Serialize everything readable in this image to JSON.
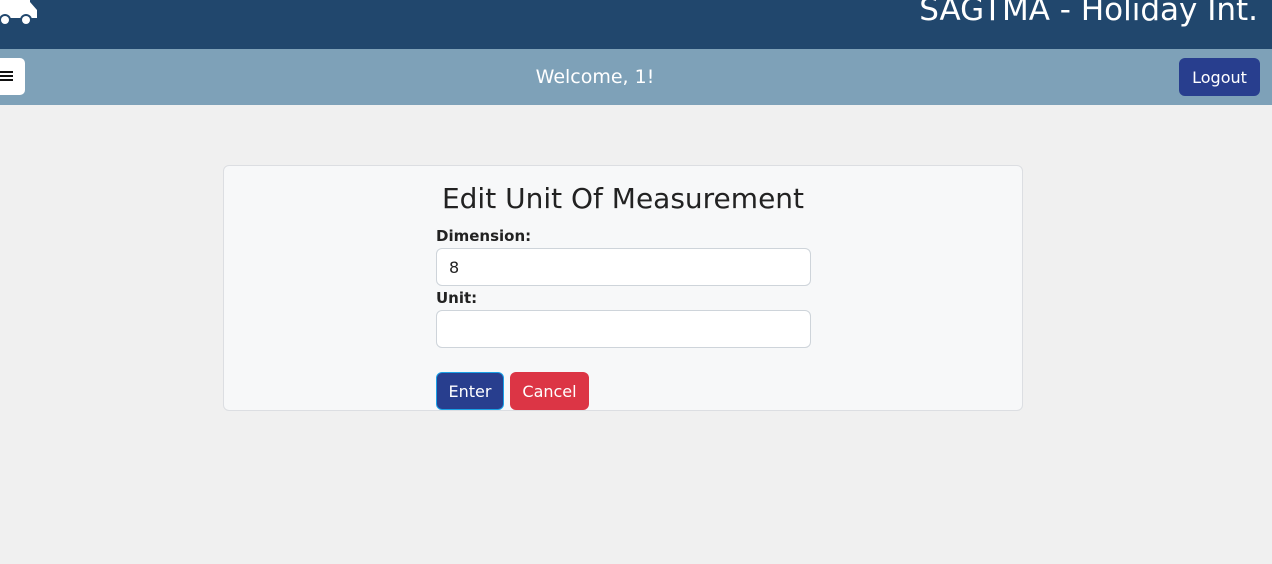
{
  "header": {
    "app_title": "SAGTMA - Holiday Int.",
    "logo_icon": "truck-icon",
    "background_color": "#21476d"
  },
  "navbar": {
    "menu_icon": "hamburger-menu-icon",
    "welcome_text": "Welcome, 1!",
    "logout_label": "Logout",
    "background_color": "#7ea1b8"
  },
  "form": {
    "title": "Edit Unit Of Measurement",
    "dimension": {
      "label": "Dimension:",
      "value": "8"
    },
    "unit": {
      "label": "Unit:",
      "value": ""
    },
    "enter_label": "Enter",
    "cancel_label": "Cancel"
  },
  "colors": {
    "primary_button": "#283e8e",
    "danger_button": "#dc3545",
    "page_background": "#f0f0f0"
  }
}
